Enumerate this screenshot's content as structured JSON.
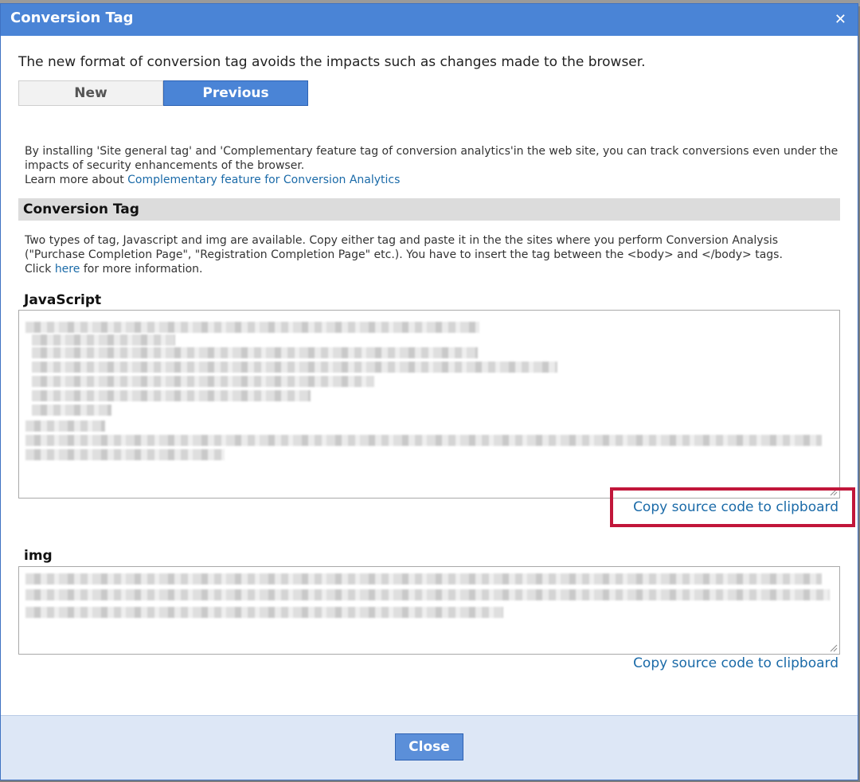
{
  "dialog": {
    "title": "Conversion Tag",
    "close_icon": "close-icon"
  },
  "intro": "The new format of conversion tag avoids the impacts such as changes made to the browser.",
  "tabs": [
    {
      "label": "New",
      "selected": false
    },
    {
      "label": "Previous",
      "selected": true
    }
  ],
  "info": {
    "text": "By installing 'Site general tag' and 'Complementary feature tag of conversion analytics'in the web site, you can track conversions even under the impacts of security enhancements of the browser.",
    "learn_prefix": "Learn more about ",
    "learn_link": "Complementary feature for Conversion Analytics"
  },
  "section": {
    "title": "Conversion Tag",
    "desc": "Two types of tag, Javascript and img are available. Copy either tag and paste it in the the sites where you perform Conversion Analysis (\"Purchase Completion Page\", \"Registration Completion Page\" etc.). You have to insert the tag between the <body> and </body> tags.",
    "click_prefix": "Click ",
    "here_link": "here",
    "click_suffix": " for more information."
  },
  "javascript": {
    "label": "JavaScript",
    "copy_label": "Copy source code to clipboard"
  },
  "img": {
    "label": "img",
    "copy_label": "Copy source code to clipboard"
  },
  "footer": {
    "close_label": "Close"
  },
  "colors": {
    "titlebar": "#4a84d6",
    "link": "#1a6aa8",
    "highlight": "#c1163a",
    "footer": "#dde7f6"
  }
}
